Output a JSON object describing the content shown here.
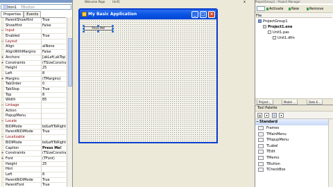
{
  "object_inspector": {
    "selected_object": "Button1",
    "selected_type": "TButton",
    "tabs": [
      "Properties",
      "Events"
    ],
    "properties": [
      {
        "name": "ParentShowHint",
        "value": "True",
        "kind": "prop"
      },
      {
        "name": "ShowHint",
        "value": "False",
        "kind": "prop"
      },
      {
        "name": "Input",
        "value": "",
        "kind": "cat"
      },
      {
        "name": "Enabled",
        "value": "True",
        "kind": "prop"
      },
      {
        "name": "Layout",
        "value": "",
        "kind": "cat"
      },
      {
        "name": "Align",
        "value": "alNone",
        "kind": "prop"
      },
      {
        "name": "AlignWithMargins",
        "value": "False",
        "kind": "prop"
      },
      {
        "name": "Anchors",
        "value": "[akLeft,akTop]",
        "kind": "prop",
        "gutter": "+"
      },
      {
        "name": "Constraints",
        "value": "(TSizeConstrai",
        "kind": "prop",
        "gutter": "+"
      },
      {
        "name": "Height",
        "value": "25",
        "kind": "prop"
      },
      {
        "name": "Left",
        "value": "8",
        "kind": "prop"
      },
      {
        "name": "Margins",
        "value": "(TMargins)",
        "kind": "prop",
        "gutter": "+"
      },
      {
        "name": "TabOrder",
        "value": "0",
        "kind": "prop"
      },
      {
        "name": "TabStop",
        "value": "True",
        "kind": "prop"
      },
      {
        "name": "Top",
        "value": "8",
        "kind": "prop"
      },
      {
        "name": "Width",
        "value": "85",
        "kind": "prop"
      },
      {
        "name": "Linkage",
        "value": "",
        "kind": "cat"
      },
      {
        "name": "Action",
        "value": "",
        "kind": "prop"
      },
      {
        "name": "PopupMenu",
        "value": "",
        "kind": "prop"
      },
      {
        "name": "Locale",
        "value": "",
        "kind": "cat"
      },
      {
        "name": "BiDiMode",
        "value": "bdLeftToRight",
        "kind": "prop"
      },
      {
        "name": "ParentBiDiMode",
        "value": "True",
        "kind": "prop"
      },
      {
        "name": "Localizable",
        "value": "",
        "kind": "cat"
      },
      {
        "name": "BiDiMode",
        "value": "bdLeftToRight",
        "kind": "prop"
      },
      {
        "name": "Caption",
        "value": "Press Me!",
        "kind": "prop",
        "bold": true
      },
      {
        "name": "Constraints",
        "value": "(TSizeConstrai",
        "kind": "prop",
        "gutter": "+"
      },
      {
        "name": "Font",
        "value": "(TFont)",
        "kind": "prop",
        "gutter": "+"
      },
      {
        "name": "Height",
        "value": "25",
        "kind": "prop"
      },
      {
        "name": "Hint",
        "value": "",
        "kind": "prop"
      },
      {
        "name": "Left",
        "value": "8",
        "kind": "prop"
      },
      {
        "name": "ParentBiDiMode",
        "value": "True",
        "kind": "prop"
      },
      {
        "name": "ParentFont",
        "value": "True",
        "kind": "prop"
      }
    ]
  },
  "ide": {
    "tabs": [
      "Welcome Page",
      "Unit1"
    ],
    "closer": "x"
  },
  "form": {
    "title": "My Basic Application",
    "button_caption": "Press Me!"
  },
  "project_manager": {
    "title": "ProjectGroup1 - Project Manager",
    "toolbar": [
      "Activate",
      "New",
      "Remove"
    ],
    "header": "File",
    "tree": [
      {
        "label": "ProjectGroup1",
        "icon": "grp",
        "depth": 0,
        "bold": false
      },
      {
        "label": "Project1.exe",
        "icon": "exe",
        "depth": 1,
        "bold": true
      },
      {
        "label": "Unit1.pas",
        "icon": "pas",
        "depth": 2,
        "bold": false
      },
      {
        "label": "Unit1.dfm",
        "icon": "dfm",
        "depth": 3,
        "bold": false
      }
    ],
    "bottom_tabs": [
      "Project...",
      "Model ...",
      "Data E..."
    ]
  },
  "tool_palette": {
    "title": "Tool Palette",
    "category": "Standard",
    "items": [
      "Frames",
      "TMainMenu",
      "TPopupMenu",
      "TLabel",
      "TEdit",
      "TMemo",
      "TButton",
      "TCheckBox"
    ]
  }
}
